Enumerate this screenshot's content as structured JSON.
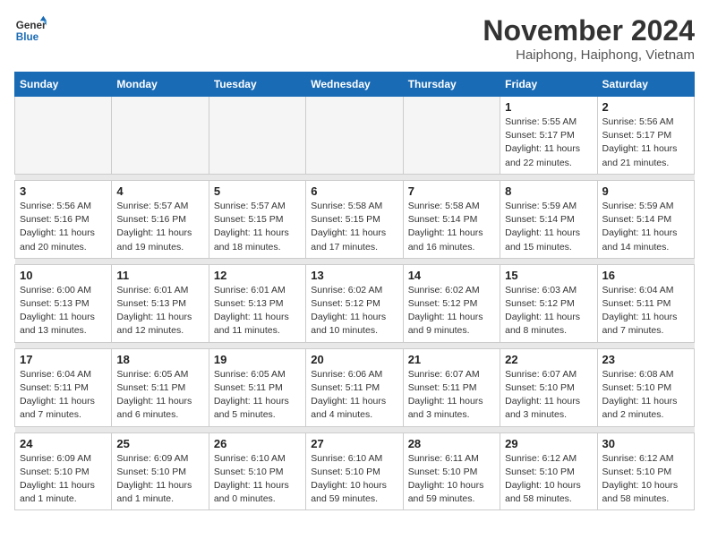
{
  "header": {
    "logo_line1": "General",
    "logo_line2": "Blue",
    "month": "November 2024",
    "location": "Haiphong, Haiphong, Vietnam"
  },
  "weekdays": [
    "Sunday",
    "Monday",
    "Tuesday",
    "Wednesday",
    "Thursday",
    "Friday",
    "Saturday"
  ],
  "weeks": [
    [
      {
        "day": "",
        "info": ""
      },
      {
        "day": "",
        "info": ""
      },
      {
        "day": "",
        "info": ""
      },
      {
        "day": "",
        "info": ""
      },
      {
        "day": "",
        "info": ""
      },
      {
        "day": "1",
        "info": "Sunrise: 5:55 AM\nSunset: 5:17 PM\nDaylight: 11 hours\nand 22 minutes."
      },
      {
        "day": "2",
        "info": "Sunrise: 5:56 AM\nSunset: 5:17 PM\nDaylight: 11 hours\nand 21 minutes."
      }
    ],
    [
      {
        "day": "3",
        "info": "Sunrise: 5:56 AM\nSunset: 5:16 PM\nDaylight: 11 hours\nand 20 minutes."
      },
      {
        "day": "4",
        "info": "Sunrise: 5:57 AM\nSunset: 5:16 PM\nDaylight: 11 hours\nand 19 minutes."
      },
      {
        "day": "5",
        "info": "Sunrise: 5:57 AM\nSunset: 5:15 PM\nDaylight: 11 hours\nand 18 minutes."
      },
      {
        "day": "6",
        "info": "Sunrise: 5:58 AM\nSunset: 5:15 PM\nDaylight: 11 hours\nand 17 minutes."
      },
      {
        "day": "7",
        "info": "Sunrise: 5:58 AM\nSunset: 5:14 PM\nDaylight: 11 hours\nand 16 minutes."
      },
      {
        "day": "8",
        "info": "Sunrise: 5:59 AM\nSunset: 5:14 PM\nDaylight: 11 hours\nand 15 minutes."
      },
      {
        "day": "9",
        "info": "Sunrise: 5:59 AM\nSunset: 5:14 PM\nDaylight: 11 hours\nand 14 minutes."
      }
    ],
    [
      {
        "day": "10",
        "info": "Sunrise: 6:00 AM\nSunset: 5:13 PM\nDaylight: 11 hours\nand 13 minutes."
      },
      {
        "day": "11",
        "info": "Sunrise: 6:01 AM\nSunset: 5:13 PM\nDaylight: 11 hours\nand 12 minutes."
      },
      {
        "day": "12",
        "info": "Sunrise: 6:01 AM\nSunset: 5:13 PM\nDaylight: 11 hours\nand 11 minutes."
      },
      {
        "day": "13",
        "info": "Sunrise: 6:02 AM\nSunset: 5:12 PM\nDaylight: 11 hours\nand 10 minutes."
      },
      {
        "day": "14",
        "info": "Sunrise: 6:02 AM\nSunset: 5:12 PM\nDaylight: 11 hours\nand 9 minutes."
      },
      {
        "day": "15",
        "info": "Sunrise: 6:03 AM\nSunset: 5:12 PM\nDaylight: 11 hours\nand 8 minutes."
      },
      {
        "day": "16",
        "info": "Sunrise: 6:04 AM\nSunset: 5:11 PM\nDaylight: 11 hours\nand 7 minutes."
      }
    ],
    [
      {
        "day": "17",
        "info": "Sunrise: 6:04 AM\nSunset: 5:11 PM\nDaylight: 11 hours\nand 7 minutes."
      },
      {
        "day": "18",
        "info": "Sunrise: 6:05 AM\nSunset: 5:11 PM\nDaylight: 11 hours\nand 6 minutes."
      },
      {
        "day": "19",
        "info": "Sunrise: 6:05 AM\nSunset: 5:11 PM\nDaylight: 11 hours\nand 5 minutes."
      },
      {
        "day": "20",
        "info": "Sunrise: 6:06 AM\nSunset: 5:11 PM\nDaylight: 11 hours\nand 4 minutes."
      },
      {
        "day": "21",
        "info": "Sunrise: 6:07 AM\nSunset: 5:11 PM\nDaylight: 11 hours\nand 3 minutes."
      },
      {
        "day": "22",
        "info": "Sunrise: 6:07 AM\nSunset: 5:10 PM\nDaylight: 11 hours\nand 3 minutes."
      },
      {
        "day": "23",
        "info": "Sunrise: 6:08 AM\nSunset: 5:10 PM\nDaylight: 11 hours\nand 2 minutes."
      }
    ],
    [
      {
        "day": "24",
        "info": "Sunrise: 6:09 AM\nSunset: 5:10 PM\nDaylight: 11 hours\nand 1 minute."
      },
      {
        "day": "25",
        "info": "Sunrise: 6:09 AM\nSunset: 5:10 PM\nDaylight: 11 hours\nand 1 minute."
      },
      {
        "day": "26",
        "info": "Sunrise: 6:10 AM\nSunset: 5:10 PM\nDaylight: 11 hours\nand 0 minutes."
      },
      {
        "day": "27",
        "info": "Sunrise: 6:10 AM\nSunset: 5:10 PM\nDaylight: 10 hours\nand 59 minutes."
      },
      {
        "day": "28",
        "info": "Sunrise: 6:11 AM\nSunset: 5:10 PM\nDaylight: 10 hours\nand 59 minutes."
      },
      {
        "day": "29",
        "info": "Sunrise: 6:12 AM\nSunset: 5:10 PM\nDaylight: 10 hours\nand 58 minutes."
      },
      {
        "day": "30",
        "info": "Sunrise: 6:12 AM\nSunset: 5:10 PM\nDaylight: 10 hours\nand 58 minutes."
      }
    ]
  ]
}
